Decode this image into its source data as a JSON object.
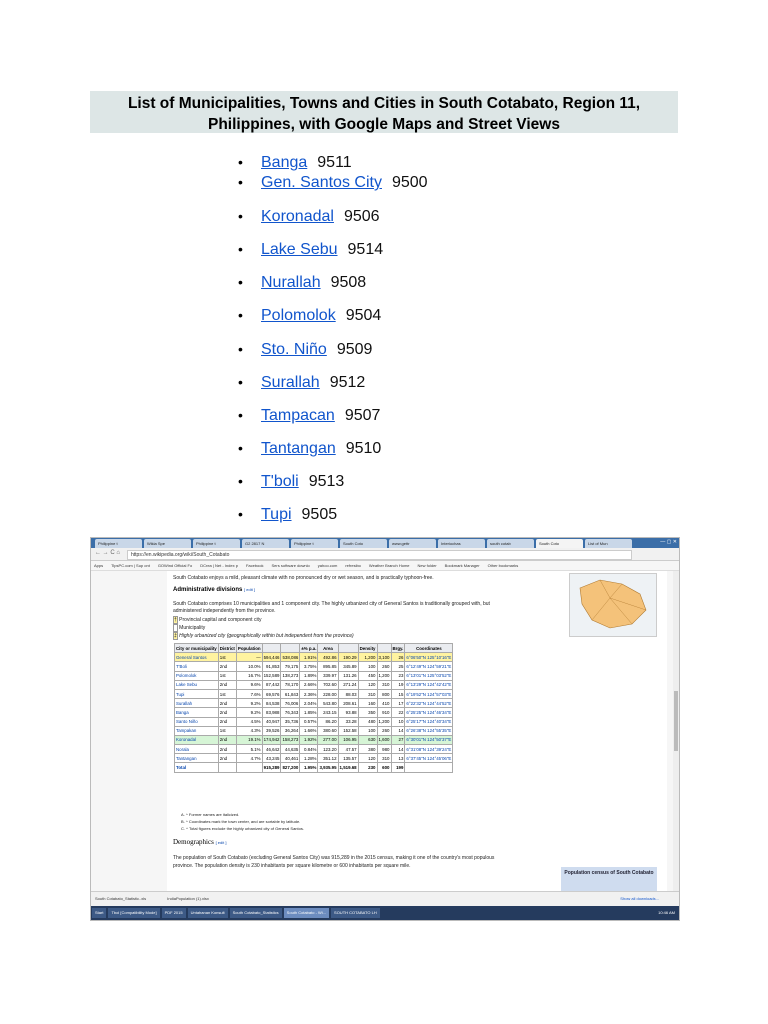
{
  "page": {
    "title_line1": "List of Municipalities, Towns and Cities in South Cotabato, Region 11,",
    "title_line2": "Philippines, with Google Maps and Street Views"
  },
  "municipalities": [
    {
      "name": "Banga",
      "zip": "9511"
    },
    {
      "name": "Gen. Santos City",
      "zip": "9500"
    },
    {
      "name": "Koronadal",
      "zip": "9506"
    },
    {
      "name": "Lake Sebu",
      "zip": "9514"
    },
    {
      "name": "Nurallah",
      "zip": "9508"
    },
    {
      "name": "Polomolok",
      "zip": "9504"
    },
    {
      "name": "Sto. Niño",
      "zip": "9509"
    },
    {
      "name": "Surallah",
      "zip": "9512"
    },
    {
      "name": "Tampacan",
      "zip": "9507"
    },
    {
      "name": "Tantangan",
      "zip": "9510"
    },
    {
      "name": "T'boli",
      "zip": "9513"
    },
    {
      "name": "Tupi",
      "zip": "9505"
    }
  ],
  "bullet": "•",
  "screenshot": {
    "tabs": [
      "Philippine t",
      "Wikia Spe",
      "Philippine t",
      "G2 2817 N",
      "Philippine t",
      "South Coto",
      "www.gettr",
      "Interiochas",
      "south cotab",
      "South Coto",
      "List of Mun"
    ],
    "url": "https://en.wikipedia.org/wiki/South_Cotabato",
    "bookmarks": [
      "Apps",
      "TipsPC.com | Sup ont",
      "GOWind Official Fo",
      "DCrea | Net - Index p",
      "Facebook",
      "Sers software downlo",
      "yahoo.com",
      "refresibo",
      "Weather Branch Home",
      "New folder",
      "Bookmark Manager",
      "Other bookmarks"
    ],
    "intro": "South Cotabato enjoys a mild, pleasant climate with no pronounced dry or wet season, and is practically typhoon-free.",
    "admin_heading": "Administrative divisions",
    "edit": "[ edit ]",
    "admin_text1": "South Cotabato comprises 10 municipalities and 1 component city. The highly urbanized city of General Santos is traditionally grouped with, but",
    "admin_text2": "administered independently from the province.",
    "legend": [
      "Provincial capital and component city",
      "Municipality",
      "Highly urbanized city (geographically within but independent from the province)"
    ],
    "table_headers": [
      "City or municipality",
      "District",
      "Population",
      "",
      "",
      "±% p.a.",
      "Area",
      "",
      "Density",
      "",
      "Brgy.",
      "Coordinates"
    ],
    "table_rows": [
      [
        "General Santos",
        "1st",
        "—",
        "594,446",
        "538,086",
        "1.91%",
        "492.86",
        "190.29",
        "1,200",
        "3,100",
        "26",
        "6°06'50\"N 125°10'16\"E"
      ],
      [
        "T'Boli",
        "2nd",
        "10.0%",
        "91,853",
        "79,175",
        "3.75%",
        "895.85",
        "345.89",
        "100",
        "260",
        "25",
        "6°12'49\"N 124°59'21\"E"
      ],
      [
        "Polomolok",
        "1st",
        "16.7%",
        "152,589",
        "138,273",
        "1.89%",
        "339.97",
        "131.26",
        "450",
        "1,200",
        "23",
        "6°13'01\"N 125°03'52\"E"
      ],
      [
        "Lake Sebu",
        "2nd",
        "9.6%",
        "87,442",
        "78,170",
        "2.66%",
        "702.60",
        "271.24",
        "120",
        "310",
        "19",
        "6°13'29\"N 124°42'42\"E"
      ],
      [
        "Tupi",
        "1st",
        "7.6%",
        "69,576",
        "61,843",
        "2.36%",
        "228.00",
        "88.03",
        "310",
        "800",
        "15",
        "6°19'52\"N 124°57'03\"E"
      ],
      [
        "Surallah",
        "2nd",
        "9.2%",
        "84,538",
        "76,006",
        "2.04%",
        "543.80",
        "208.61",
        "160",
        "410",
        "17",
        "6°22'32\"N 124°44'52\"E"
      ],
      [
        "Banga",
        "2nd",
        "9.2%",
        "83,988",
        "76,343",
        "1.85%",
        "243.15",
        "93.88",
        "350",
        "910",
        "22",
        "6°25'25\"N 124°46'34\"E"
      ],
      [
        "Santo Niño",
        "2nd",
        "4.5%",
        "40,947",
        "35,736",
        "0.57%",
        "86.20",
        "33.28",
        "480",
        "1,200",
        "10",
        "6°25'17\"N 124°40'34\"E"
      ],
      [
        "Tampakan",
        "1st",
        "4.3%",
        "39,526",
        "36,264",
        "1.66%",
        "380.60",
        "152.58",
        "100",
        "260",
        "14",
        "6°26'38\"N 124°55'35\"E"
      ],
      [
        "Koronadal",
        "2nd",
        "19.1%",
        "174,942",
        "158,273",
        "1.92%",
        "277.00",
        "106.95",
        "630",
        "1,600",
        "27",
        "6°30'01\"N 124°50'37\"E"
      ],
      [
        "Norala",
        "2nd",
        "5.1%",
        "46,642",
        "44,635",
        "0.84%",
        "123.20",
        "47.57",
        "380",
        "980",
        "14",
        "6°31'08\"N 124°39'24\"E"
      ],
      [
        "Tantangan",
        "2nd",
        "4.7%",
        "43,245",
        "40,461",
        "1.28%",
        "351.12",
        "135.57",
        "120",
        "310",
        "13",
        "6°37'45\"N 124°45'06\"E"
      ],
      [
        "Total",
        "",
        "",
        "915,289",
        "827,200",
        "1.95%",
        "3,935.95",
        "1,519.68",
        "230",
        "600",
        "199",
        ""
      ]
    ],
    "footnotes": [
      "A. ^ Former names are italicized.",
      "B. ^ Coordinates mark the town center, and are sortable by latitude.",
      "C. ^ Total figures exclude the highly urbanized city of General Santos."
    ],
    "demographics_heading": "Demographics",
    "demo_text1": "The population of South Cotabato (excluding General Santos City) was 915,289 in the 2015 census, making it one of the country's most populous",
    "demo_text2": "province. The population density is 230 inhabitants per square kilometre or 600 inhabitants per square mile.",
    "census_box": "Population census of South Cotabato",
    "downloads": [
      "South Cotabato_Statistic..xls",
      "IndiaPopulation (1).xlsx",
      "Show all downloads..."
    ],
    "taskbar": [
      "Start",
      "Tbol [Compatibility Mode]",
      "PDF 2015",
      "Untahanan Konsult",
      "South Cotabato_Statistics",
      "South Cotabato - Wi...",
      "SOUTH COTABATO LH"
    ],
    "clock": "10:46 AM"
  }
}
